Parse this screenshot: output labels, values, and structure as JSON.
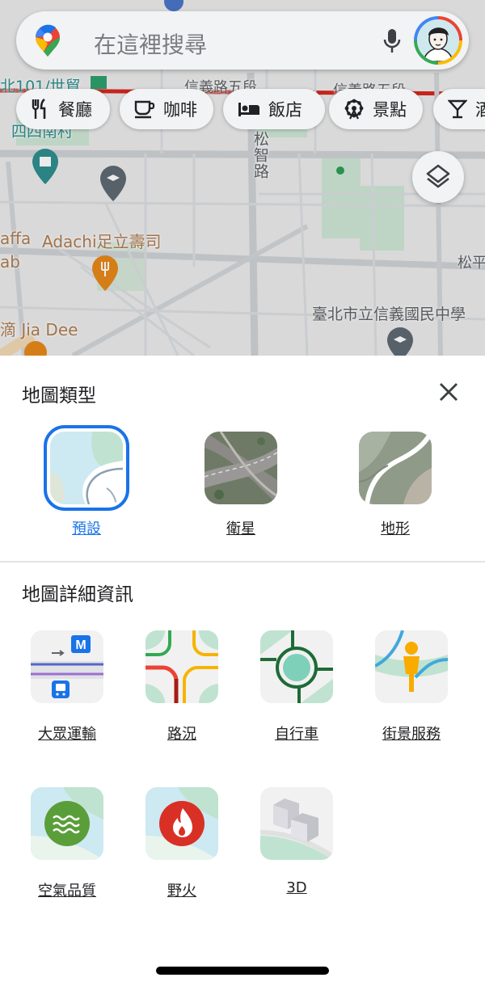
{
  "search": {
    "placeholder": "在這裡搜尋",
    "icons": [
      "maps-pin-icon",
      "mic-icon",
      "avatar"
    ]
  },
  "chips": [
    {
      "label": "餐廳",
      "icon": "restaurant-icon"
    },
    {
      "label": "咖啡",
      "icon": "coffee-icon"
    },
    {
      "label": "飯店",
      "icon": "hotel-icon"
    },
    {
      "label": "景點",
      "icon": "attractions-icon"
    },
    {
      "label": "酒",
      "icon": "bar-icon"
    }
  ],
  "map": {
    "labels": {
      "taipei101": "北101/世貿",
      "xinyi_road_1": "信義路五段",
      "xinyi_road_2": "信義路五段",
      "simen": "四四南村",
      "songzhi": "松智路",
      "affa": "affa",
      "adachi": "Adachi足立壽司",
      "ab": "ab",
      "songping": "松平",
      "school": "臺北市立信義國民中學",
      "jiadee": "滴 Jia Dee"
    }
  },
  "sheet": {
    "map_type_title": "地圖類型",
    "map_types": [
      {
        "label": "預設",
        "selected": true
      },
      {
        "label": "衛星",
        "selected": false
      },
      {
        "label": "地形",
        "selected": false
      }
    ],
    "map_details_title": "地圖詳細資訊",
    "details": [
      {
        "label": "大眾運輸",
        "icon": "transit-icon"
      },
      {
        "label": "路況",
        "icon": "traffic-icon"
      },
      {
        "label": "自行車",
        "icon": "biking-icon"
      },
      {
        "label": "街景服務",
        "icon": "street-view-icon"
      },
      {
        "label": "空氣品質",
        "icon": "air-quality-icon"
      },
      {
        "label": "野火",
        "icon": "wildfire-icon"
      },
      {
        "label": "3D",
        "icon": "3d-icon"
      }
    ]
  },
  "colors": {
    "accent": "#1a73e8",
    "map_bg": "#ececec",
    "park": "#cfe6d6",
    "label_brown": "#b07d52",
    "pin_orange": "#e8891a"
  }
}
